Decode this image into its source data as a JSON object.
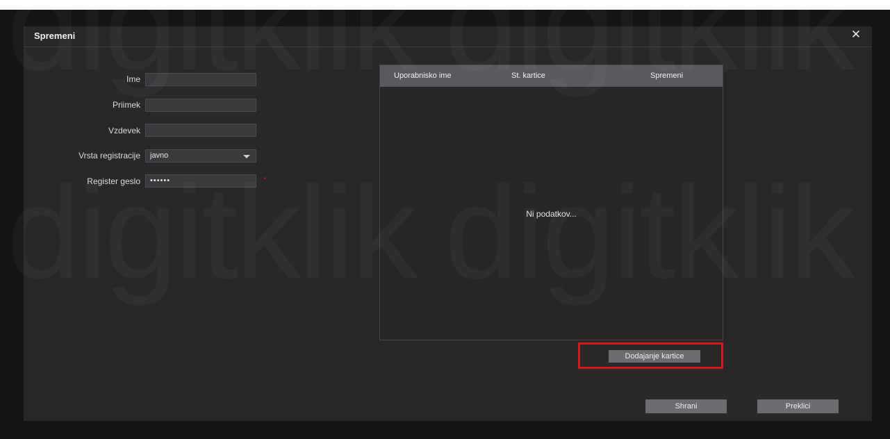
{
  "dialog": {
    "title": "Spremeni",
    "close_symbol": "✕"
  },
  "form": {
    "name_label": "Ime",
    "name_value": "",
    "surname_label": "Priimek",
    "surname_value": "",
    "nickname_label": "Vzdevek",
    "nickname_value": "",
    "registration_type_label": "Vrsta registracije",
    "registration_type_value": "javno",
    "register_password_label": "Register geslo",
    "register_password_value": "••••••",
    "required_mark": "*"
  },
  "card_table": {
    "columns": [
      "Uporabnisko ime",
      "St. kartice",
      "Spremeni"
    ],
    "empty_message": "Ni podatkov..."
  },
  "buttons": {
    "add_card": "Dodajanje kartice",
    "save": "Shrani",
    "cancel": "Preklici"
  },
  "watermark_text": "digitklik",
  "colors": {
    "dialog_bg": "#28282a",
    "table_header_bg": "#5a5a5e",
    "button_bg": "#6c6c70",
    "highlight": "#d5171d",
    "required": "#c0221d"
  }
}
